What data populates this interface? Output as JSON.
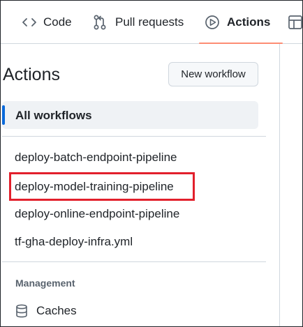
{
  "tabs": {
    "code": "Code",
    "pull_requests": "Pull requests",
    "actions": "Actions"
  },
  "sidebar": {
    "title": "Actions",
    "new_workflow_label": "New workflow",
    "all_workflows_label": "All workflows",
    "workflows": [
      {
        "label": "deploy-batch-endpoint-pipeline"
      },
      {
        "label": "deploy-model-training-pipeline",
        "highlighted": true
      },
      {
        "label": "deploy-online-endpoint-pipeline"
      },
      {
        "label": "tf-gha-deploy-infra.yml"
      }
    ],
    "management_heading": "Management",
    "caches_label": "Caches"
  },
  "colors": {
    "active_tab_underline": "#fd8c73",
    "selected_accent": "#0969da",
    "highlight_box": "#e2202c"
  },
  "icons": {
    "code_tab": "code-icon",
    "pulls_tab": "git-pull-request-icon",
    "actions_tab": "play-icon",
    "more_tab": "table-icon",
    "caches": "database-icon"
  }
}
